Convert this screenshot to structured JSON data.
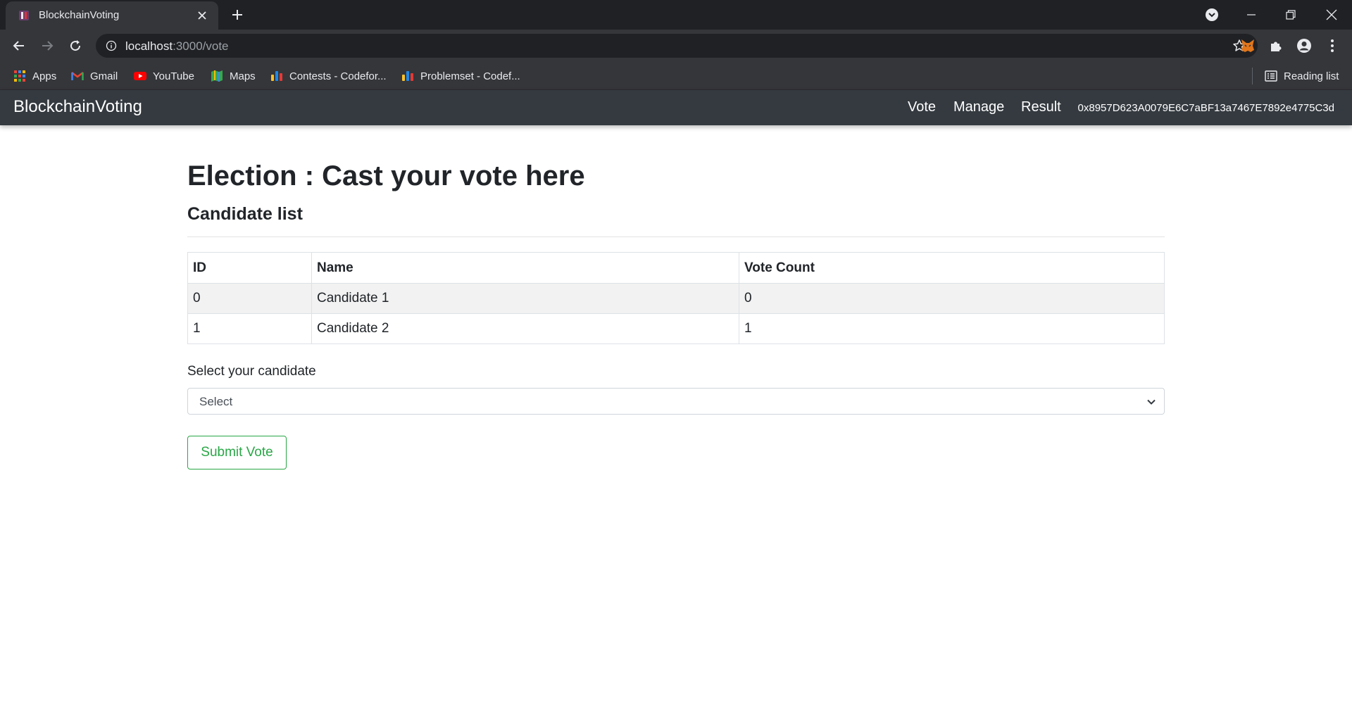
{
  "browser": {
    "tab": {
      "title": "BlockchainVoting"
    },
    "url": {
      "host": "localhost",
      "path": ":3000/vote"
    },
    "bookmarks": [
      {
        "label": "Apps",
        "icon": "apps-grid-icon"
      },
      {
        "label": "Gmail",
        "icon": "gmail-icon"
      },
      {
        "label": "YouTube",
        "icon": "youtube-icon"
      },
      {
        "label": "Maps",
        "icon": "maps-icon"
      },
      {
        "label": "Contests - Codefor...",
        "icon": "codeforces-icon"
      },
      {
        "label": "Problemset - Codef...",
        "icon": "codeforces-icon"
      }
    ],
    "reading_list": "Reading list"
  },
  "app": {
    "brand": "BlockchainVoting",
    "nav": {
      "vote": "Vote",
      "manage": "Manage",
      "result": "Result"
    },
    "account": "0x8957D623A0079E6C7aBF13a7467E7892e4775C3d"
  },
  "main": {
    "title": "Election : Cast your vote here",
    "subtitle": "Candidate list",
    "table": {
      "headers": [
        "ID",
        "Name",
        "Vote Count"
      ],
      "rows": [
        {
          "id": "0",
          "name": "Candidate 1",
          "votes": "0"
        },
        {
          "id": "1",
          "name": "Candidate 2",
          "votes": "1"
        }
      ]
    },
    "select_label": "Select your candidate",
    "select_value": "Select",
    "submit_label": "Submit Vote"
  },
  "colors": {
    "navbar": "#343a40",
    "success": "#28a745",
    "chrome_dark": "#202124",
    "chrome_toolbar": "#35363a"
  }
}
